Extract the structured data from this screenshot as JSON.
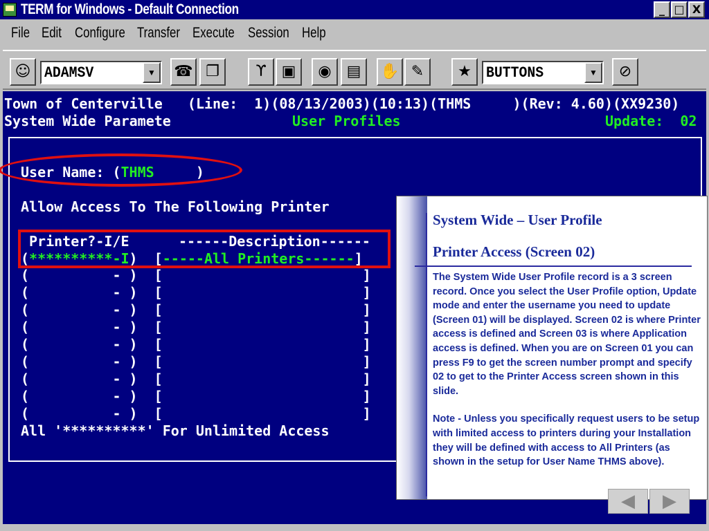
{
  "window": {
    "title": "TERM for Windows - Default Connection",
    "buttons": {
      "minimize": "_",
      "maximize": "□",
      "close": "X"
    }
  },
  "menu": [
    "File",
    "Edit",
    "Configure",
    "Transfer",
    "Execute",
    "Session",
    "Help"
  ],
  "toolbar": {
    "connection_value": "ADAMSV",
    "buttons_value": "BUTTONS",
    "icons": [
      "person-icon",
      "phone-icon",
      "copy-icon",
      "antenna-icon",
      "computer-icon",
      "paint-icon",
      "book-icon",
      "hand-icon",
      "pen-icon",
      "runner-icon",
      "no-icon"
    ]
  },
  "terminal": {
    "header1": "Town of Centerville   (Line:  1)(08/13/2003)(10:13)(THMS     )(Rev: 4.60)(XX9230)",
    "header2_left": "System Wide Paramete",
    "header2_center": "User Profiles",
    "header2_right": "Update:  02",
    "user_name_label": "User Name: (",
    "user_name_value": "THMS",
    "user_name_close": "     )",
    "allow_access": "Allow Access To The Following Printer",
    "col_printer": "Printer?-I/E",
    "col_description": "------Description------",
    "first_row": {
      "open": "(",
      "printer": "**********-I",
      "close": ")",
      "desc_open": "[",
      "desc": "-----All Printers------",
      "desc_close": "]"
    },
    "empty_rows": [
      "(          - )  [                        ]",
      "(          - )  [                        ]",
      "(          - )  [                        ]",
      "(          - )  [                        ]",
      "(          - )  [                        ]",
      "(          - )  [                        ]",
      "(          - )  [                        ]",
      "(          - )  [                        ]",
      "(          - )  [                        ]"
    ],
    "footer": "All '**********' For Unlimited Access"
  },
  "panel": {
    "title1": "System Wide – User Profile",
    "title2": "Printer Access (Screen 02)",
    "para1": "The System Wide User Profile record is a 3 screen record. Once you select the User Profile option,  Update mode and enter the username you need to update (Screen 01) will be displayed.   Screen 02 is where Printer access is defined and Screen 03 is where Application access is defined.   When you are on Screen 01 you can press F9 to get the screen number prompt and specify 02 to get to the Printer Access screen shown in this slide.",
    "para2": "Note - Unless you specifically request users to be setup with limited access to printers during your Installation they will be defined with access to All Printers (as shown in the setup for User Name THMS above)."
  },
  "nav": {
    "prev": "◀",
    "next": "▶"
  },
  "colors": {
    "terminal_bg": "#000080",
    "terminal_text": "#ffffff",
    "highlight_green": "#22ee22",
    "annotation_red": "#e01010",
    "panel_text": "#1a2a9a"
  }
}
